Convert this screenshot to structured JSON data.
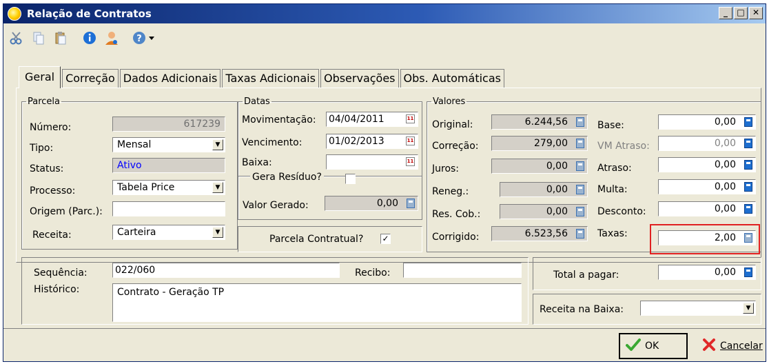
{
  "window": {
    "title": "Relação de Contratos"
  },
  "toolbar": {
    "icons": [
      "scissors-icon",
      "copy-icon",
      "paste-icon",
      "info-icon",
      "user-icon",
      "help-icon",
      "dropdown-arrow-icon"
    ]
  },
  "tabs": [
    {
      "label": "Geral",
      "active": true
    },
    {
      "label": "Correção"
    },
    {
      "label": "Dados Adicionais"
    },
    {
      "label": "Taxas Adicionais"
    },
    {
      "label": "Observações"
    },
    {
      "label": "Obs. Automáticas"
    }
  ],
  "parcela": {
    "legend": "Parcela",
    "numero_label": "Número:",
    "numero_value": "617239",
    "tipo_label": "Tipo:",
    "tipo_value": "Mensal",
    "status_label": "Status:",
    "status_value": "Ativo",
    "processo_label": "Processo:",
    "processo_value": "Tabela Price",
    "origem_label": "Origem (Parc.):",
    "origem_value": "",
    "receita_label": "Receita:",
    "receita_value": "Carteira"
  },
  "datas": {
    "legend": "Datas",
    "movimentacao_label": "Movimentação:",
    "movimentacao_value": "04/04/2011",
    "vencimento_label": "Vencimento:",
    "vencimento_value": "01/02/2013",
    "baixa_label": "Baixa:",
    "baixa_value": "",
    "calendar_icon_text": "11"
  },
  "gera_residuo": {
    "legend": "Gera Resíduo?",
    "valor_gerado_label": "Valor Gerado:",
    "valor_gerado_value": "0,00"
  },
  "parcela_contratual": {
    "label": "Parcela Contratual?",
    "checked_mark": "✓"
  },
  "valores": {
    "legend": "Valores",
    "original_label": "Original:",
    "original_value": "6.244,56",
    "correcao_label": "Correção:",
    "correcao_value": "279,00",
    "juros_label": "Juros:",
    "juros_value": "0,00",
    "reneg_label": "Reneg.:",
    "reneg_value": "0,00",
    "res_cob_label": "Res. Cob.:",
    "res_cob_value": "0,00",
    "corrigido_label": "Corrigido:",
    "corrigido_value": "6.523,56",
    "base_label": "Base:",
    "base_value": "0,00",
    "vm_atraso_label": "VM Atraso:",
    "vm_atraso_value": "0,00",
    "atraso_label": "Atraso:",
    "atraso_value": "0,00",
    "multa_label": "Multa:",
    "multa_value": "0,00",
    "desconto_label": "Desconto:",
    "desconto_value": "0,00",
    "taxas_label": "Taxas:",
    "taxas_value": "2,00"
  },
  "bottom": {
    "sequencia_label": "Sequência:",
    "sequencia_value": "022/060",
    "recibo_label": "Recibo:",
    "recibo_value": "",
    "historico_label": "Histórico:",
    "historico_value": "Contrato - Geração TP",
    "total_label": "Total a pagar:",
    "total_value": "0,00",
    "receita_baixa_label": "Receita na Baixa:",
    "receita_baixa_value": ""
  },
  "buttons": {
    "ok": "OK",
    "cancel": "Cancelar"
  },
  "colors": {
    "title_gradient_start": "#0a246a",
    "highlight": "#e02020",
    "status_text": "#0000ff"
  }
}
